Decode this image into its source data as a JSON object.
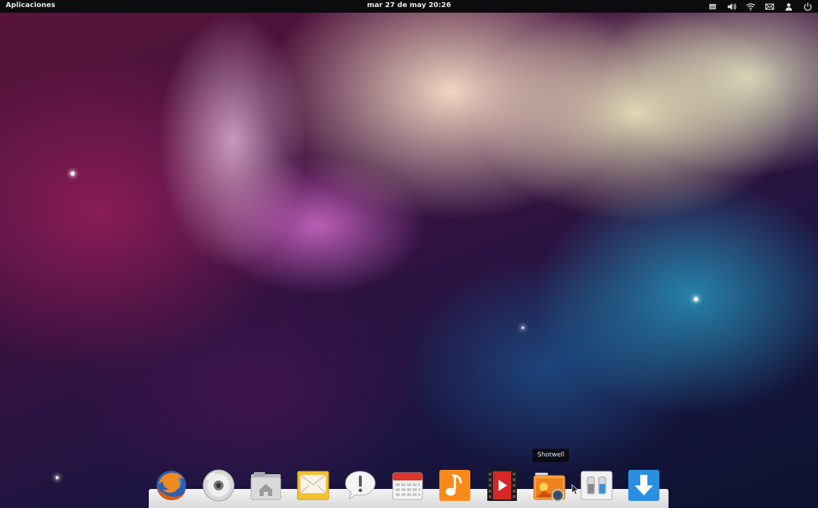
{
  "topbar": {
    "applications_label": "Aplicaciones",
    "clock": "mar 27 de may 20:26",
    "indicators": [
      "window-icon",
      "volume-icon",
      "wifi-icon",
      "mail-icon",
      "user-icon",
      "power-icon"
    ]
  },
  "tooltip": {
    "text": "Shotwell"
  },
  "dock": {
    "items": [
      {
        "app": "firefox",
        "icon": "firefox-icon"
      },
      {
        "app": "disc",
        "icon": "disc-icon"
      },
      {
        "app": "files",
        "icon": "home-folder-icon"
      },
      {
        "app": "mail",
        "icon": "mail-envelope-icon"
      },
      {
        "app": "notifications",
        "icon": "speech-bubble-icon"
      },
      {
        "app": "calendar",
        "icon": "calendar-icon"
      },
      {
        "app": "music",
        "icon": "music-note-icon"
      },
      {
        "app": "videos",
        "icon": "video-film-icon"
      },
      {
        "app": "shotwell",
        "icon": "photo-camera-icon"
      },
      {
        "app": "settings",
        "icon": "switches-icon"
      },
      {
        "app": "software-center",
        "icon": "download-arrow-icon"
      }
    ]
  },
  "colors": {
    "topbar_bg": "#0c0c0e",
    "dock_bg": "#e6e6e6",
    "firefox_orange": "#e8701a",
    "mail_yellow": "#f2c22e",
    "calendar_red": "#e0352a",
    "music_orange": "#f88a1c",
    "video_red": "#d62828",
    "download_blue": "#2a8fe0"
  }
}
